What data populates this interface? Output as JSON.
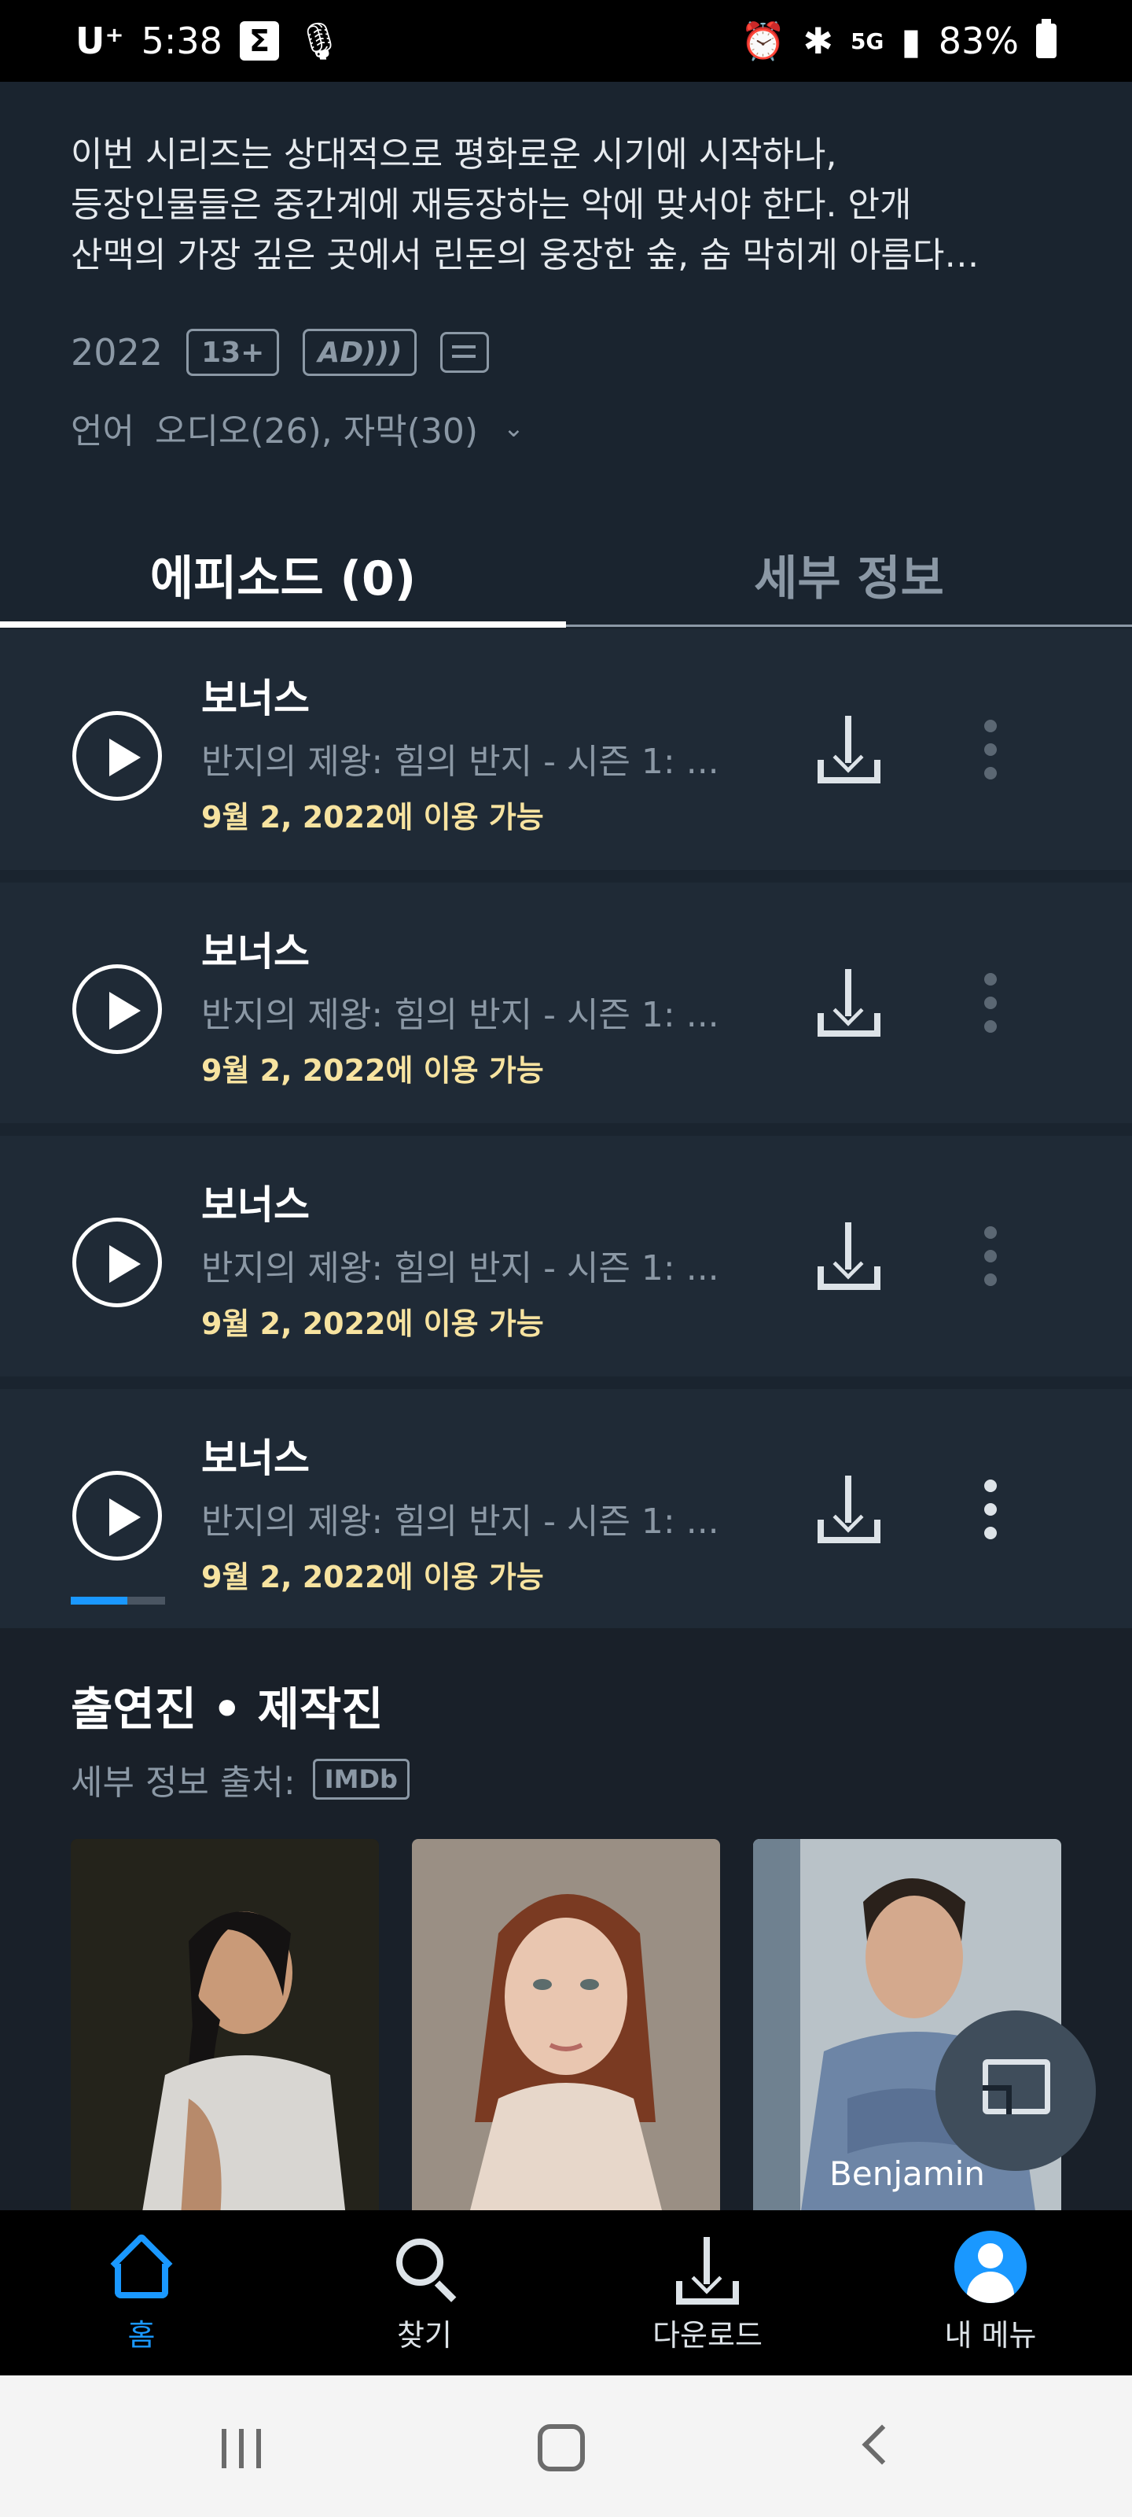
{
  "status_bar": {
    "carrier": "U⁺",
    "time": "5:38",
    "network": "5G",
    "battery": "83%"
  },
  "description": {
    "lines": [
      "이번 시리즈는 상대적으로 평화로운 시기에 시작하나,",
      "등장인물들은 중간계에 재등장하는 악에 맞서야 한다. 안개",
      "산맥의 가장 깊은 곳에서 린돈의 웅장한 숲, 숨 막히게 아름다…"
    ],
    "year": "2022",
    "rating": "13+",
    "ad_badge": "AD)))",
    "language_label": "언어",
    "language_value": "오디오(26), 자막(30)"
  },
  "tabs": {
    "episodes": "에피소드 (0)",
    "details": "세부 정보"
  },
  "episodes": [
    {
      "title": "보너스",
      "subtitle": "반지의 제왕: 힘의 반지 - 시즌 1: ...",
      "availability": "9월 2, 2022에 이용 가능",
      "progress": 0
    },
    {
      "title": "보너스",
      "subtitle": "반지의 제왕: 힘의 반지 - 시즌 1: ...",
      "availability": "9월 2, 2022에 이용 가능",
      "progress": 0
    },
    {
      "title": "보너스",
      "subtitle": "반지의 제왕: 힘의 반지 - 시즌 1: ...",
      "availability": "9월 2, 2022에 이용 가능",
      "progress": 0
    },
    {
      "title": "보너스",
      "subtitle": "반지의 제왕: 힘의 반지 - 시즌 1: ...",
      "availability": "9월 2, 2022에 이용 가능",
      "progress": 0.6
    }
  ],
  "cast": {
    "title": "출연진 • 제작진",
    "source_label": "세부 정보 출처:",
    "source_badge": "IMDb",
    "people": [
      {
        "name": ""
      },
      {
        "name": ""
      },
      {
        "name": "Benjamin"
      }
    ]
  },
  "bottom_nav": {
    "home": "홈",
    "search": "찾기",
    "downloads": "다운로드",
    "my_menu": "내 메뉴"
  },
  "colors": {
    "accent": "#1a98ff",
    "availability": "#f7e3a0",
    "background": "#1a242f"
  }
}
